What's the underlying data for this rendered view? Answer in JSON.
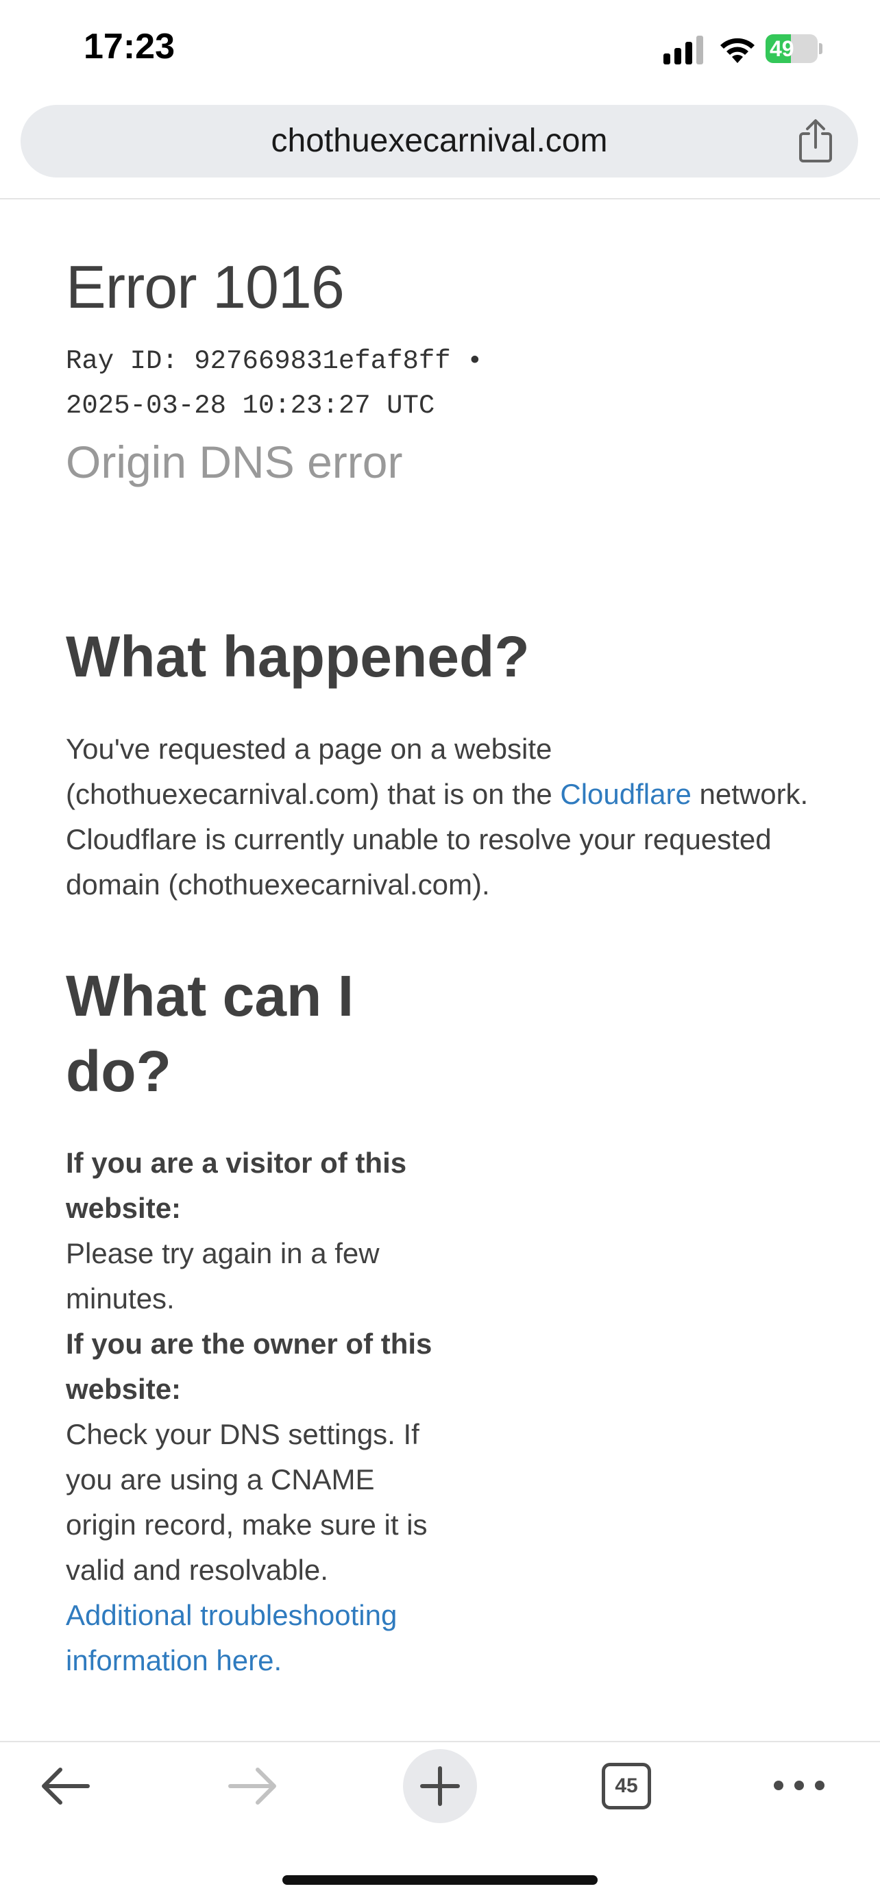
{
  "status_bar": {
    "time": "17:23",
    "battery_text": "49",
    "battery_level": 0.49,
    "icons": [
      "signal-icon",
      "wifi-icon",
      "battery-icon"
    ]
  },
  "browser": {
    "url": "chothuexecarnival.com",
    "share_icon": "share-icon",
    "tab_count": "45",
    "toolbar_icons": [
      "back-arrow-icon",
      "forward-arrow-icon",
      "plus-icon",
      "tabs-icon",
      "more-icon"
    ]
  },
  "error": {
    "title": "Error 1016",
    "ray_line1": "Ray ID: 927669831efaf8ff •",
    "ray_line2": "2025-03-28 10:23:27 UTC",
    "subtitle": "Origin DNS error"
  },
  "what_happened": {
    "heading": "What happened?",
    "text_before_link": "You've requested a page on a website (chothuexecarnival.com) that is on the ",
    "link_text": "Cloudflare",
    "text_after_link": " network. Cloudflare is currently unable to resolve your requested domain (chothuexecarnival.com)."
  },
  "what_can_i_do": {
    "heading": "What can I do?",
    "visitor_label": "If you are a visitor of this website:",
    "visitor_text": "Please try again in a few minutes.",
    "owner_label": "If you are the owner of this website:",
    "owner_text": "Check your DNS settings. If you are using a CNAME origin record, make sure it is valid and resolvable.",
    "link_text": "Additional troubleshooting information here."
  },
  "colors": {
    "link": "#2f7bbf",
    "battery_fill": "#34c759",
    "heading": "#404040",
    "subtitle": "#999999"
  }
}
